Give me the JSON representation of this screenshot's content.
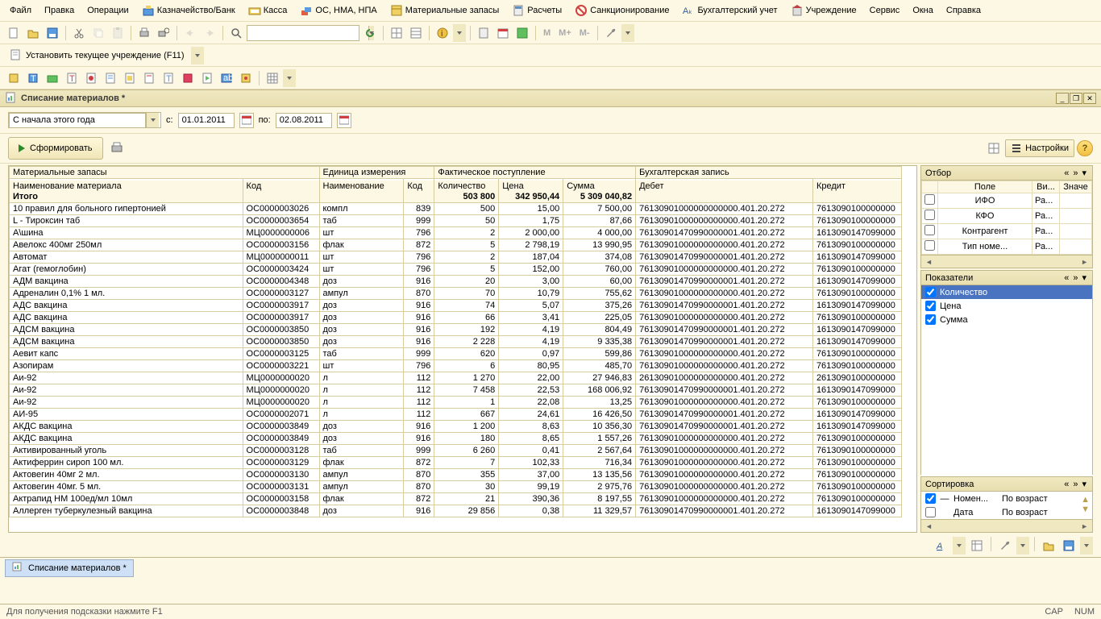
{
  "menu": {
    "file": "Файл",
    "edit": "Правка",
    "ops": "Операции",
    "treasury": "Казначейство/Банк",
    "cash": "Касса",
    "assets": "ОС, НМА, НПА",
    "inventory": "Материальные запасы",
    "calc": "Расчеты",
    "sanction": "Санкционирование",
    "accounting": "Бухгалтерский учет",
    "org": "Учреждение",
    "service": "Сервис",
    "windows": "Окна",
    "help": "Справка"
  },
  "toolbar2": {
    "set_org": "Установить текущее учреждение (F11)"
  },
  "doc": {
    "title": "Списание материалов *"
  },
  "period": {
    "range_label": "С начала этого года",
    "from_label": "с:",
    "from": "01.01.2011",
    "to_label": "по:",
    "to": "02.08.2011"
  },
  "form_btn": "Сформировать",
  "settings_btn": "Настройки",
  "grid": {
    "group_headers": {
      "mat": "Материальные запасы",
      "unit": "Единица измерения",
      "fact": "Фактическое поступление",
      "acct": "Бухгалтерская запись"
    },
    "headers": {
      "name": "Наименование материала",
      "code": "Код",
      "unit_name": "Наименование",
      "unit_code": "Код",
      "qty": "Количество",
      "price": "Цена",
      "sum": "Сумма",
      "debit": "Дебет",
      "credit": "Кредит"
    },
    "total_label": "Итого",
    "totals": {
      "qty": "503 800",
      "sum1": "342 950,44",
      "sum2": "5 309 040,82"
    },
    "rows": [
      {
        "name": "10 правил для больного гипертонией",
        "code": "ОС0000003026",
        "unit": "компл",
        "ucode": "839",
        "qty": "500",
        "price": "15,00",
        "sum": "7 500,00",
        "debit": "76130901000000000000.401.20.272",
        "credit": "7613090100000000"
      },
      {
        "name": "L - Тироксин таб",
        "code": "ОС0000003654",
        "unit": "таб",
        "ucode": "999",
        "qty": "50",
        "price": "1,75",
        "sum": "87,66",
        "debit": "76130901000000000000.401.20.272",
        "credit": "7613090100000000"
      },
      {
        "name": "А\\шина",
        "code": "МЦ0000000006",
        "unit": "шт",
        "ucode": "796",
        "qty": "2",
        "price": "2 000,00",
        "sum": "4 000,00",
        "debit": "76130901470990000001.401.20.272",
        "credit": "1613090147099000"
      },
      {
        "name": "Авелокс 400мг 250мл",
        "code": "ОС0000003156",
        "unit": "флак",
        "ucode": "872",
        "qty": "5",
        "price": "2 798,19",
        "sum": "13 990,95",
        "debit": "76130901000000000000.401.20.272",
        "credit": "7613090100000000"
      },
      {
        "name": "Автомат",
        "code": "МЦ0000000011",
        "unit": "шт",
        "ucode": "796",
        "qty": "2",
        "price": "187,04",
        "sum": "374,08",
        "debit": "76130901470990000001.401.20.272",
        "credit": "1613090147099000"
      },
      {
        "name": "Агат (гемоглобин)",
        "code": "ОС0000003424",
        "unit": "шт",
        "ucode": "796",
        "qty": "5",
        "price": "152,00",
        "sum": "760,00",
        "debit": "76130901000000000000.401.20.272",
        "credit": "7613090100000000"
      },
      {
        "name": "АДМ вакцина",
        "code": "ОС0000004348",
        "unit": "доз",
        "ucode": "916",
        "qty": "20",
        "price": "3,00",
        "sum": "60,00",
        "debit": "76130901470990000001.401.20.272",
        "credit": "1613090147099000"
      },
      {
        "name": "Адреналин 0,1% 1 мл.",
        "code": "ОС0000003127",
        "unit": "ампул",
        "ucode": "870",
        "qty": "70",
        "price": "10,79",
        "sum": "755,62",
        "debit": "76130901000000000000.401.20.272",
        "credit": "7613090100000000"
      },
      {
        "name": "АДС вакцина",
        "code": "ОС0000003917",
        "unit": "доз",
        "ucode": "916",
        "qty": "74",
        "price": "5,07",
        "sum": "375,26",
        "debit": "76130901470990000001.401.20.272",
        "credit": "1613090147099000"
      },
      {
        "name": "АДС вакцина",
        "code": "ОС0000003917",
        "unit": "доз",
        "ucode": "916",
        "qty": "66",
        "price": "3,41",
        "sum": "225,05",
        "debit": "76130901000000000000.401.20.272",
        "credit": "7613090100000000"
      },
      {
        "name": "АДСМ вакцина",
        "code": "ОС0000003850",
        "unit": "доз",
        "ucode": "916",
        "qty": "192",
        "price": "4,19",
        "sum": "804,49",
        "debit": "76130901470990000001.401.20.272",
        "credit": "1613090147099000"
      },
      {
        "name": "АДСМ вакцина",
        "code": "ОС0000003850",
        "unit": "доз",
        "ucode": "916",
        "qty": "2 228",
        "price": "4,19",
        "sum": "9 335,38",
        "debit": "76130901470990000001.401.20.272",
        "credit": "1613090147099000"
      },
      {
        "name": "Аевит капс",
        "code": "ОС0000003125",
        "unit": "таб",
        "ucode": "999",
        "qty": "620",
        "price": "0,97",
        "sum": "599,86",
        "debit": "76130901000000000000.401.20.272",
        "credit": "7613090100000000"
      },
      {
        "name": "Азопирам",
        "code": "ОС0000003221",
        "unit": "шт",
        "ucode": "796",
        "qty": "6",
        "price": "80,95",
        "sum": "485,70",
        "debit": "76130901000000000000.401.20.272",
        "credit": "7613090100000000"
      },
      {
        "name": "Аи-92",
        "code": "МЦ0000000020",
        "unit": "л",
        "ucode": "112",
        "qty": "1 270",
        "price": "22,00",
        "sum": "27 946,83",
        "debit": "26130901000000000000.401.20.272",
        "credit": "2613090100000000"
      },
      {
        "name": "Аи-92",
        "code": "МЦ0000000020",
        "unit": "л",
        "ucode": "112",
        "qty": "7 458",
        "price": "22,53",
        "sum": "168 006,92",
        "debit": "76130901470990000001.401.20.272",
        "credit": "1613090147099000"
      },
      {
        "name": "Аи-92",
        "code": "МЦ0000000020",
        "unit": "л",
        "ucode": "112",
        "qty": "1",
        "price": "22,08",
        "sum": "13,25",
        "debit": "76130901000000000000.401.20.272",
        "credit": "7613090100000000"
      },
      {
        "name": "АИ-95",
        "code": "ОС0000002071",
        "unit": "л",
        "ucode": "112",
        "qty": "667",
        "price": "24,61",
        "sum": "16 426,50",
        "debit": "76130901470990000001.401.20.272",
        "credit": "1613090147099000"
      },
      {
        "name": "АКДС вакцина",
        "code": "ОС0000003849",
        "unit": "доз",
        "ucode": "916",
        "qty": "1 200",
        "price": "8,63",
        "sum": "10 356,30",
        "debit": "76130901470990000001.401.20.272",
        "credit": "1613090147099000"
      },
      {
        "name": "АКДС вакцина",
        "code": "ОС0000003849",
        "unit": "доз",
        "ucode": "916",
        "qty": "180",
        "price": "8,65",
        "sum": "1 557,26",
        "debit": "76130901000000000000.401.20.272",
        "credit": "7613090100000000"
      },
      {
        "name": "Активированный уголь",
        "code": "ОС0000003128",
        "unit": "таб",
        "ucode": "999",
        "qty": "6 260",
        "price": "0,41",
        "sum": "2 567,64",
        "debit": "76130901000000000000.401.20.272",
        "credit": "7613090100000000"
      },
      {
        "name": "Актиферрин сироп 100 мл.",
        "code": "ОС0000003129",
        "unit": "флак",
        "ucode": "872",
        "qty": "7",
        "price": "102,33",
        "sum": "716,34",
        "debit": "76130901000000000000.401.20.272",
        "credit": "7613090100000000"
      },
      {
        "name": "Актовегин 40мг 2 мл.",
        "code": "ОС0000003130",
        "unit": "ампул",
        "ucode": "870",
        "qty": "355",
        "price": "37,00",
        "sum": "13 135,56",
        "debit": "76130901000000000000.401.20.272",
        "credit": "7613090100000000"
      },
      {
        "name": "Актовегин 40мг. 5 мл.",
        "code": "ОС0000003131",
        "unit": "ампул",
        "ucode": "870",
        "qty": "30",
        "price": "99,19",
        "sum": "2 975,76",
        "debit": "76130901000000000000.401.20.272",
        "credit": "7613090100000000"
      },
      {
        "name": "Актрапид НМ 100ед/мл 10мл",
        "code": "ОС0000003158",
        "unit": "флак",
        "ucode": "872",
        "qty": "21",
        "price": "390,36",
        "sum": "8 197,55",
        "debit": "76130901000000000000.401.20.272",
        "credit": "7613090100000000"
      },
      {
        "name": "Аллерген туберкулезный вакцина",
        "code": "ОС0000003848",
        "unit": "доз",
        "ucode": "916",
        "qty": "29 856",
        "price": "0,38",
        "sum": "11 329,57",
        "debit": "76130901470990000001.401.20.272",
        "credit": "1613090147099000"
      }
    ]
  },
  "filter": {
    "title": "Отбор",
    "col_field": "Поле",
    "col_kind": "Ви...",
    "col_val": "Значе",
    "rows": [
      {
        "field": "ИФО",
        "kind": "Ра..."
      },
      {
        "field": "КФО",
        "kind": "Ра..."
      },
      {
        "field": "Контрагент",
        "kind": "Ра..."
      },
      {
        "field": "Тип номе...",
        "kind": "Ра..."
      }
    ]
  },
  "meas": {
    "title": "Показатели",
    "items": [
      {
        "label": "Количество",
        "checked": true,
        "selected": true
      },
      {
        "label": "Цена",
        "checked": true
      },
      {
        "label": "Сумма",
        "checked": true
      }
    ]
  },
  "sort": {
    "title": "Сортировка",
    "rows": [
      {
        "checked": true,
        "dash": "—",
        "field": "Номен...",
        "dir": "По возраст"
      },
      {
        "checked": false,
        "dash": "",
        "field": "Дата",
        "dir": "По возраст"
      }
    ]
  },
  "taskbar": {
    "tab": "Списание материалов *"
  },
  "status": {
    "hint": "Для получения подсказки нажмите F1",
    "cap": "CAP",
    "num": "NUM"
  }
}
